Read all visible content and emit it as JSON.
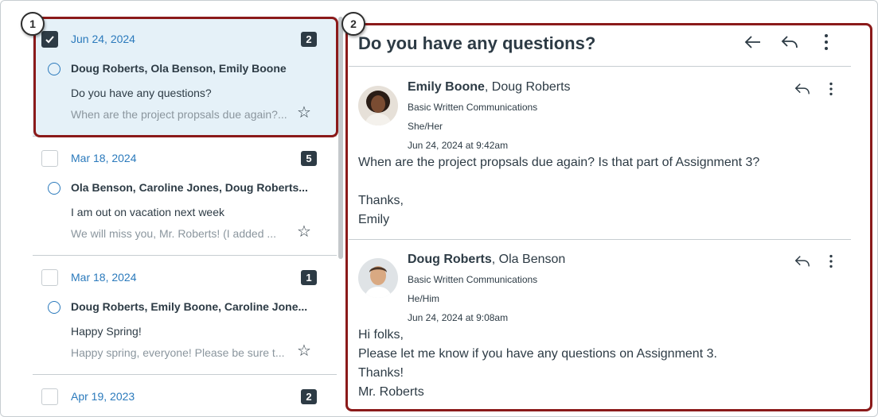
{
  "conversations": [
    {
      "date": "Jun 24, 2024",
      "count": "2",
      "participants": "Doug Roberts, Ola Benson, Emily Boone",
      "subject": "Do you have any questions?",
      "preview": "When are the project propsals due again?...",
      "selected": true,
      "checked": true
    },
    {
      "date": "Mar 18, 2024",
      "count": "5",
      "participants": "Ola Benson, Caroline Jones, Doug Roberts...",
      "subject": "I am out on vacation next week",
      "preview": "We will miss you, Mr. Roberts! (I added ...",
      "selected": false,
      "checked": false
    },
    {
      "date": "Mar 18, 2024",
      "count": "1",
      "participants": "Doug Roberts, Emily Boone, Caroline Jone...",
      "subject": "Happy Spring!",
      "preview": "Happy spring, everyone! Please be sure t...",
      "selected": false,
      "checked": false
    },
    {
      "date": "Apr 19, 2023",
      "count": "2",
      "selected": false,
      "checked": false
    }
  ],
  "detail": {
    "title": "Do you have any questions?",
    "messages": [
      {
        "author": "Emily Boone",
        "others": ", Doug Roberts",
        "course": "Basic Written Communications",
        "pronouns": "She/Her",
        "timestamp": "Jun 24, 2024 at 9:42am",
        "lines": [
          "When are the project propsals due again? Is that part of Assignment 3?",
          "",
          "Thanks,",
          "Emily"
        ]
      },
      {
        "author": "Doug Roberts",
        "others": ", Ola Benson",
        "course": "Basic Written Communications",
        "pronouns": "He/Him",
        "timestamp": "Jun 24, 2024 at 9:08am",
        "lines": [
          "Hi folks,",
          "Please let me know if you have any questions on Assignment 3.",
          "Thanks!",
          "Mr. Roberts"
        ]
      }
    ]
  },
  "callouts": [
    "1",
    "2"
  ],
  "colors": {
    "accent": "#2b7abc",
    "selected_bg": "#e5f1f8",
    "callout": "#8b1a1a",
    "text": "#2d3b45"
  },
  "icons": [
    "check-icon",
    "unread-dot-icon",
    "star-icon",
    "back-arrow-icon",
    "reply-icon",
    "more-vertical-icon"
  ]
}
